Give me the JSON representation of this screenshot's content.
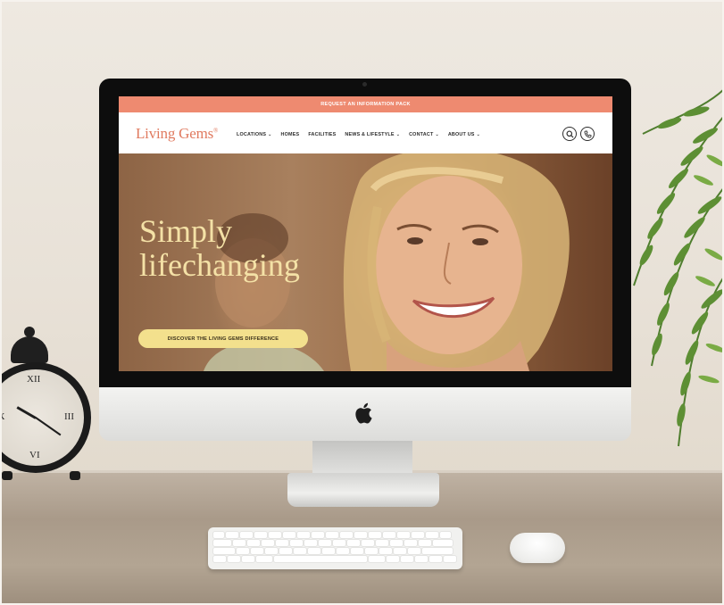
{
  "website": {
    "topbar_text": "REQUEST AN INFORMATION PACK",
    "logo": "Living Gems",
    "logo_mark": "®",
    "nav": [
      {
        "label": "LOCATIONS",
        "has_dropdown": true
      },
      {
        "label": "HOMES",
        "has_dropdown": false
      },
      {
        "label": "FACILITIES",
        "has_dropdown": false
      },
      {
        "label": "NEWS & LIFESTYLE",
        "has_dropdown": true
      },
      {
        "label": "CONTACT",
        "has_dropdown": true
      },
      {
        "label": "ABOUT US",
        "has_dropdown": true
      }
    ],
    "nav_icons": [
      "search-icon",
      "phone-icon"
    ],
    "hero": {
      "title_line1": "Simply",
      "title_line2": "lifechanging",
      "cta_label": "DISCOVER THE LIVING GEMS DIFFERENCE"
    },
    "colors": {
      "topbar": "#ee8a70",
      "logo": "#e07a5f",
      "hero_title": "#f4e1a6",
      "cta_bg": "#f3e08d"
    }
  },
  "clock_numerals": [
    "XII",
    "III",
    "VI",
    "IX"
  ],
  "caret": "⌄"
}
